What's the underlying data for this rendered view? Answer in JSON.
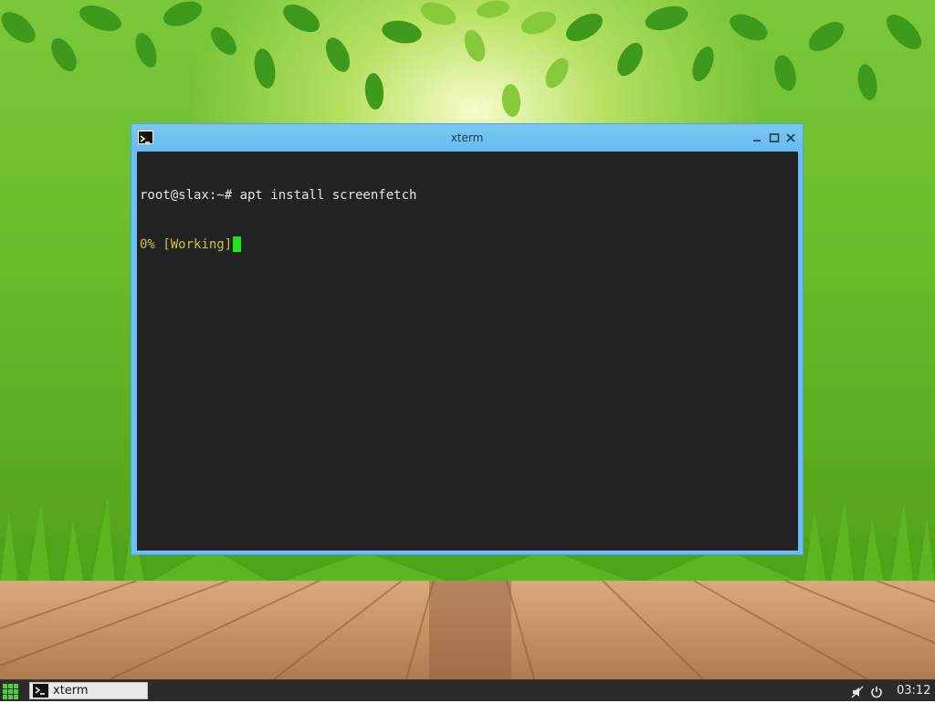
{
  "desktop": {
    "wallpaper": "green-leaves-grass-wooden-floor"
  },
  "window": {
    "title": "xterm",
    "icon": "terminal-icon",
    "controls": [
      "minimize-icon",
      "maximize-icon",
      "close-icon"
    ],
    "terminal": {
      "line1": "root@slax:~# apt install screenfetch",
      "line2": "0% [Working]",
      "prompt_color": "#e6e6e6",
      "progress_color": "#c9c632",
      "cursor_color": "#22e322"
    }
  },
  "taskbar": {
    "start_icon": "grid-menu-icon",
    "tasks": [
      {
        "label": "xterm",
        "icon": "terminal-icon"
      }
    ],
    "tray": [
      "mute-icon",
      "power-icon"
    ],
    "clock": "03:12"
  }
}
